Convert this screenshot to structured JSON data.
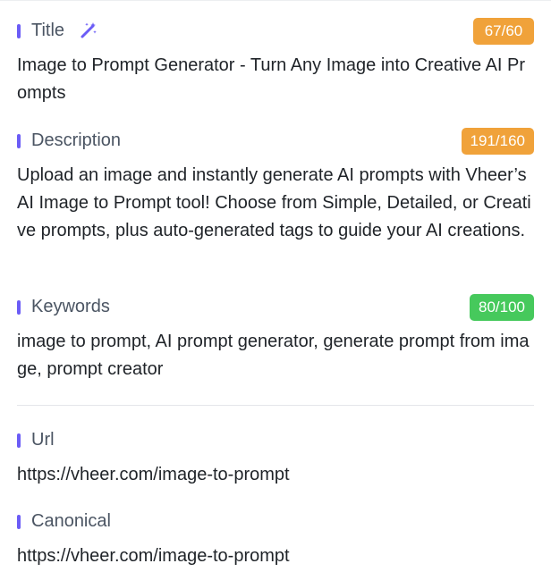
{
  "fields": {
    "title": {
      "label": "Title",
      "count": "67/60",
      "value": "Image to Prompt Generator - Turn Any Image into Creative AI Prompts"
    },
    "description": {
      "label": "Description",
      "count": "191/160",
      "value": "Upload an image and instantly generate AI prompts with Vheer’s AI Image to Prompt tool! Choose from Simple, Detailed, or Creative prompts, plus auto-generated tags to guide your AI creations."
    },
    "keywords": {
      "label": "Keywords",
      "count": "80/100",
      "value": "image to prompt, AI prompt generator, generate prompt from image, prompt creator"
    },
    "url": {
      "label": "Url",
      "value": "https://vheer.com/image-to-prompt"
    },
    "canonical": {
      "label": "Canonical",
      "value": "https://vheer.com/image-to-prompt"
    }
  },
  "colors": {
    "accent": "#6b5cf6",
    "over_limit": "#f0a23a",
    "within_limit": "#46c95c"
  },
  "icons": {
    "title_action": "magic-wand-icon"
  }
}
